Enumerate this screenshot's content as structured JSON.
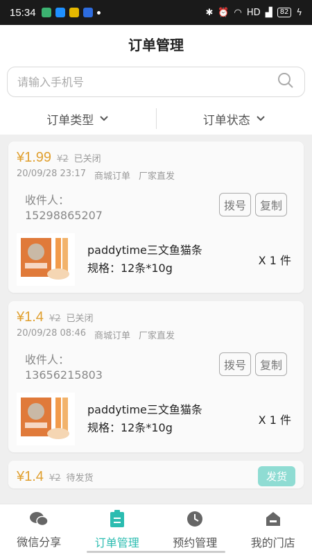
{
  "status_bar": {
    "time": "15:34",
    "network": "HD",
    "battery": "82"
  },
  "header": {
    "title": "订单管理"
  },
  "search": {
    "placeholder": "请输入手机号"
  },
  "filters": [
    {
      "label": "订单类型"
    },
    {
      "label": "订单状态"
    }
  ],
  "orders": [
    {
      "price": "¥1.99",
      "original_price": "¥2",
      "status": "已关闭",
      "datetime": "20/09/28 23:17",
      "order_type": "商城订单",
      "source": "厂家直发",
      "receiver_label": "收件人：",
      "phone": "15298865207",
      "dial_label": "拨号",
      "copy_label": "复制",
      "product_name": "paddytime三文鱼猫条",
      "spec": "规格：12条*10g",
      "qty": "X 1 件"
    },
    {
      "price": "¥1.4",
      "original_price": "¥2",
      "status": "已关闭",
      "datetime": "20/09/28 08:46",
      "order_type": "商城订单",
      "source": "厂家直发",
      "receiver_label": "收件人：",
      "phone": "13656215803",
      "dial_label": "拨号",
      "copy_label": "复制",
      "product_name": "paddytime三文鱼猫条",
      "spec": "规格：12条*10g",
      "qty": "X 1 件"
    },
    {
      "price": "¥1.4",
      "original_price": "¥2",
      "status": "待发货",
      "ship_label": "发货"
    }
  ],
  "tabs": [
    {
      "label": "微信分享",
      "icon": "wechat-icon"
    },
    {
      "label": "订单管理",
      "icon": "order-icon",
      "active": true
    },
    {
      "label": "预约管理",
      "icon": "clock-icon"
    },
    {
      "label": "我的门店",
      "icon": "store-icon"
    }
  ],
  "colors": {
    "accent": "#2bbcb0",
    "price": "#e0a030"
  }
}
